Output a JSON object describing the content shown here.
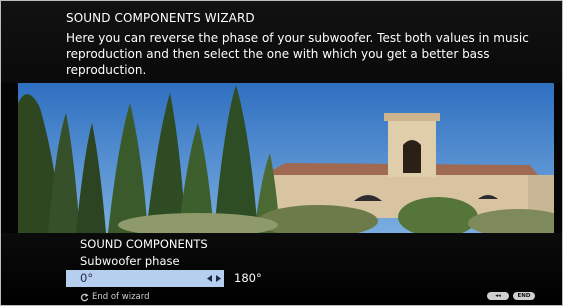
{
  "wizard": {
    "title": "SOUND COMPONENTS WIZARD",
    "description": "Here you can reverse the phase of your subwoofer. Test both values in music reproduction and then select the one with which you get a better bass reproduction."
  },
  "menu": {
    "title": "SOUND COMPONENTS",
    "setting_label": "Subwoofer phase",
    "options": [
      "0°",
      "180°"
    ],
    "selected_option": "0°"
  },
  "footer": {
    "end_of_wizard": "End of wizard",
    "rewind_key_label": "◂◂",
    "end_key_label": "END"
  },
  "icons": {
    "return": "return-icon",
    "arrows": "left-right-arrows-icon"
  },
  "colors": {
    "selection": "#b7cfee",
    "panel": "#0a0a0a",
    "text": "#ffffff"
  }
}
